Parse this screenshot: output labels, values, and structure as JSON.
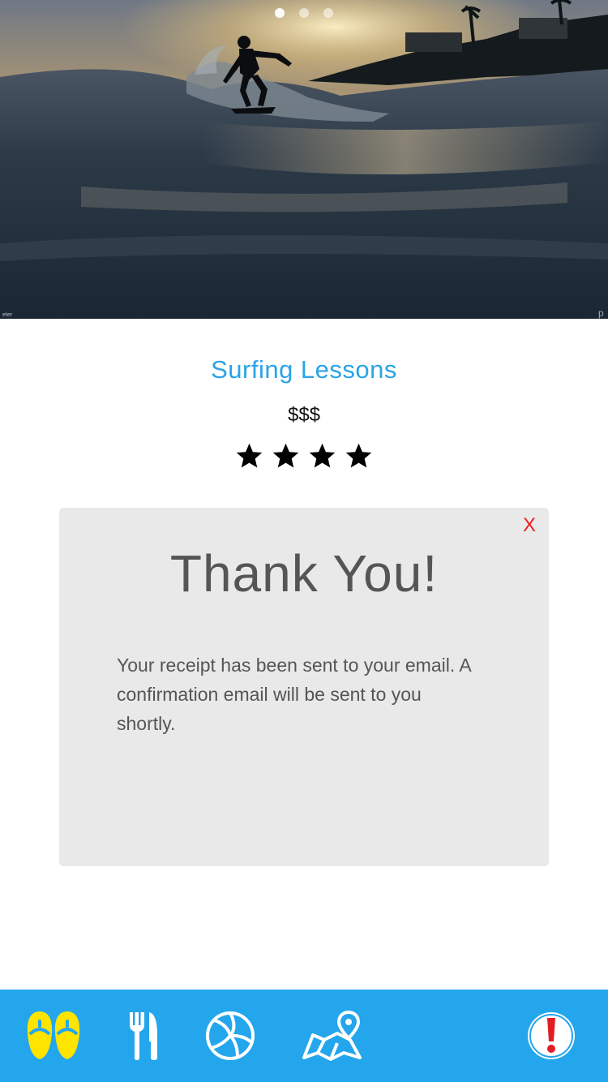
{
  "hero": {
    "carousel_count": 3,
    "carousel_active": 0,
    "icon": "surfer-photo"
  },
  "activity": {
    "title": "Surfing Lessons",
    "price": "$$$",
    "rating": 4,
    "rating_max": 4
  },
  "modal": {
    "close_label": "X",
    "title": "Thank You!",
    "message": "Your receipt has been sent to your email. A confirmation email will be sent to you shortly."
  },
  "bottom_nav": {
    "items": [
      {
        "icon": "flip-flops-icon",
        "active": true
      },
      {
        "icon": "fork-knife-icon",
        "active": false
      },
      {
        "icon": "volleyball-icon",
        "active": false
      },
      {
        "icon": "map-pin-icon",
        "active": false
      },
      {
        "icon": "alert-icon",
        "active": false
      }
    ]
  },
  "colors": {
    "accent": "#2aa3e8",
    "nav_background": "#24a6ec",
    "active_icon": "#ffe400",
    "close_red": "#ee1c1c",
    "alert_red": "#e01e25",
    "modal_background": "#e9e9e9"
  }
}
